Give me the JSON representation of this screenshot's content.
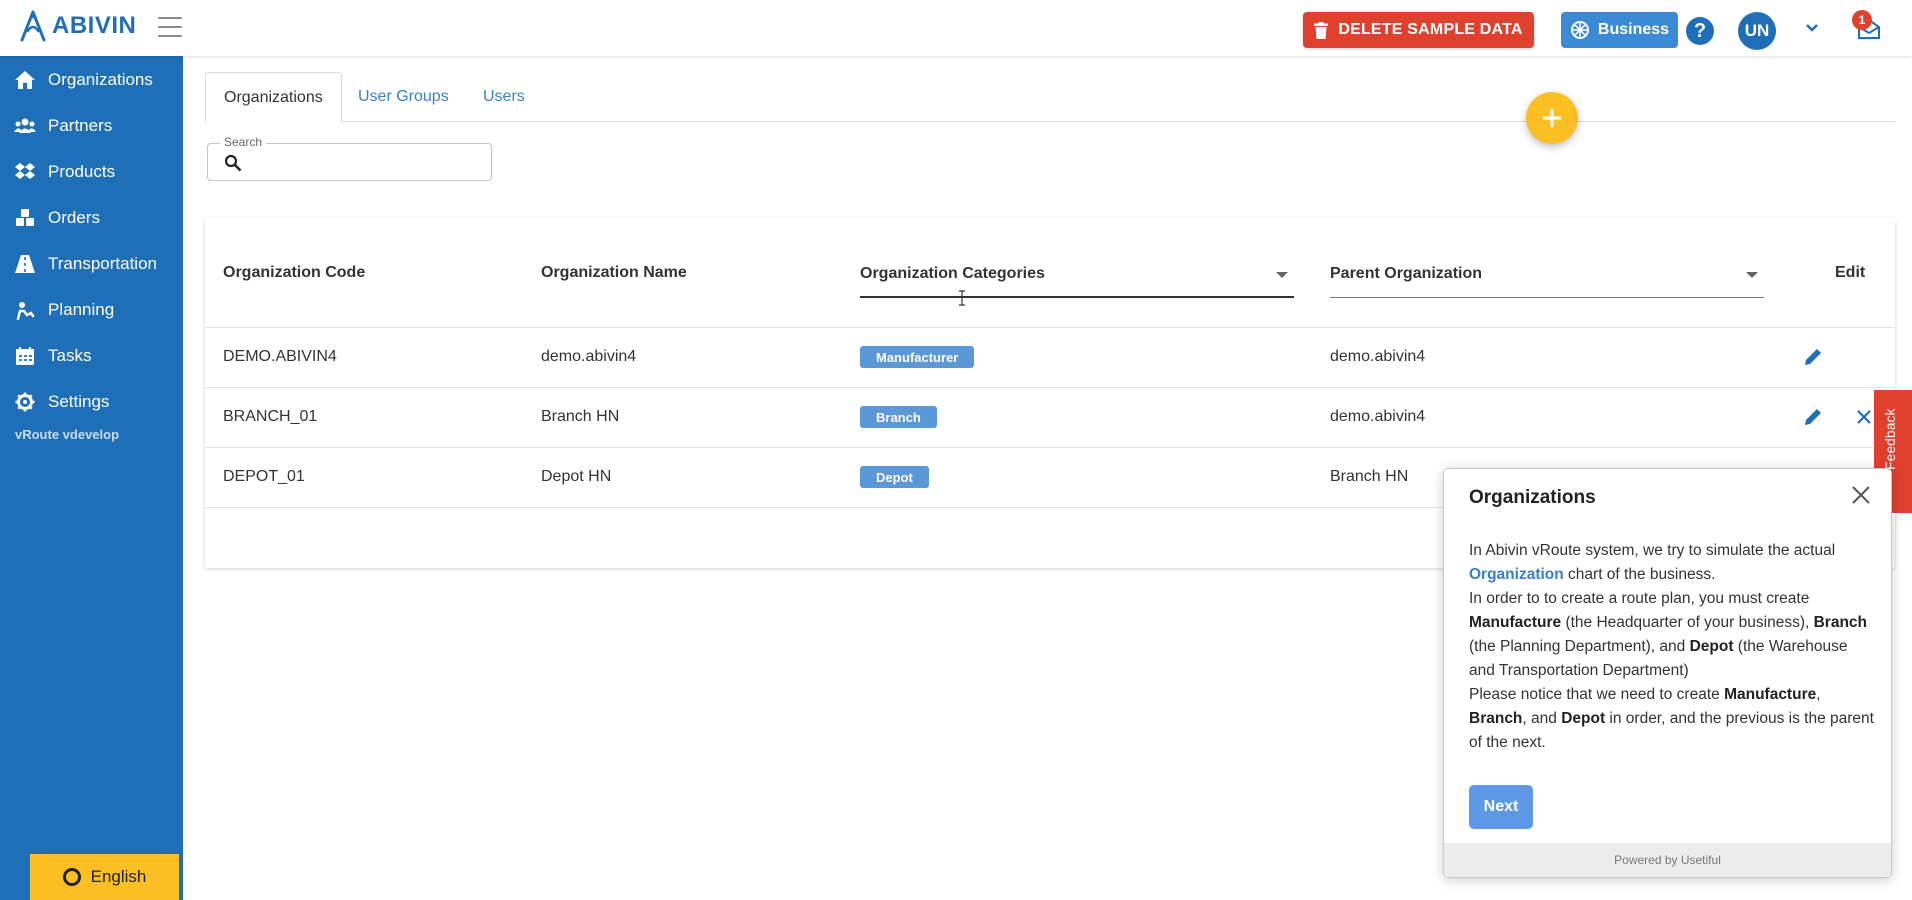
{
  "header": {
    "logo_text": "ABIVIN",
    "delete_button_label": "DELETE SAMPLE DATA",
    "business_button_label": "Business",
    "help_label": "?",
    "avatar_initials": "UN",
    "notification_count": "1",
    "colors": {
      "brand": "#1f6fb8",
      "delete": "#e0412f",
      "business": "#3a8ad6",
      "accent": "#fbbf24"
    }
  },
  "sidebar": {
    "items": [
      {
        "label": "Organizations",
        "icon": "home-icon"
      },
      {
        "label": "Partners",
        "icon": "users-icon"
      },
      {
        "label": "Products",
        "icon": "dropbox-icon"
      },
      {
        "label": "Orders",
        "icon": "cubes-icon"
      },
      {
        "label": "Transportation",
        "icon": "road-icon"
      },
      {
        "label": "Planning",
        "icon": "route-icon"
      },
      {
        "label": "Tasks",
        "icon": "calendar-icon"
      },
      {
        "label": "Settings",
        "icon": "gear-icon"
      }
    ],
    "version": "vRoute vdevelop",
    "language": "English"
  },
  "tabs": [
    {
      "label": "Organizations",
      "active": true
    },
    {
      "label": "User Groups",
      "active": false
    },
    {
      "label": "Users",
      "active": false
    }
  ],
  "search": {
    "legend": "Search",
    "placeholder": "",
    "value": ""
  },
  "table": {
    "columns": {
      "code": "Organization Code",
      "name": "Organization Name",
      "categories": "Organization Categories",
      "parent": "Parent Organization",
      "edit": "Edit"
    },
    "rows": [
      {
        "code": "DEMO.ABIVIN4",
        "name": "demo.abivin4",
        "category": "Manufacturer",
        "parent": "demo.abivin4"
      },
      {
        "code": "BRANCH_01",
        "name": "Branch HN",
        "category": "Branch",
        "parent": "demo.abivin4"
      },
      {
        "code": "DEPOT_01",
        "name": "Depot HN",
        "category": "Depot",
        "parent": "Branch HN"
      }
    ]
  },
  "feedback_label": "Feedback",
  "tour": {
    "title": "Organizations",
    "p1_a": "In Abivin vRoute system, we try to simulate the actual ",
    "p1_hl": "Organization",
    "p1_b": " chart of the business.",
    "p2_a": "In order to to create a route plan, you must create ",
    "p2_b1": "Manufacture",
    "p2_c": " (the Headquarter of your business), ",
    "p2_b2": "Branch",
    "p2_d": " (the Planning Department), and ",
    "p2_b3": "Depot",
    "p2_e": " (the Warehouse and Transportation Department)",
    "p3_a": "Please notice that we need to create ",
    "p3_b1": "Manufacture",
    "p3_c": ", ",
    "p3_b2": "Branch",
    "p3_d": ", and ",
    "p3_b3": "Depot",
    "p3_e": " in order, and the previous is the parent of the next.",
    "next_label": "Next",
    "footer": "Powered by Usetiful"
  }
}
